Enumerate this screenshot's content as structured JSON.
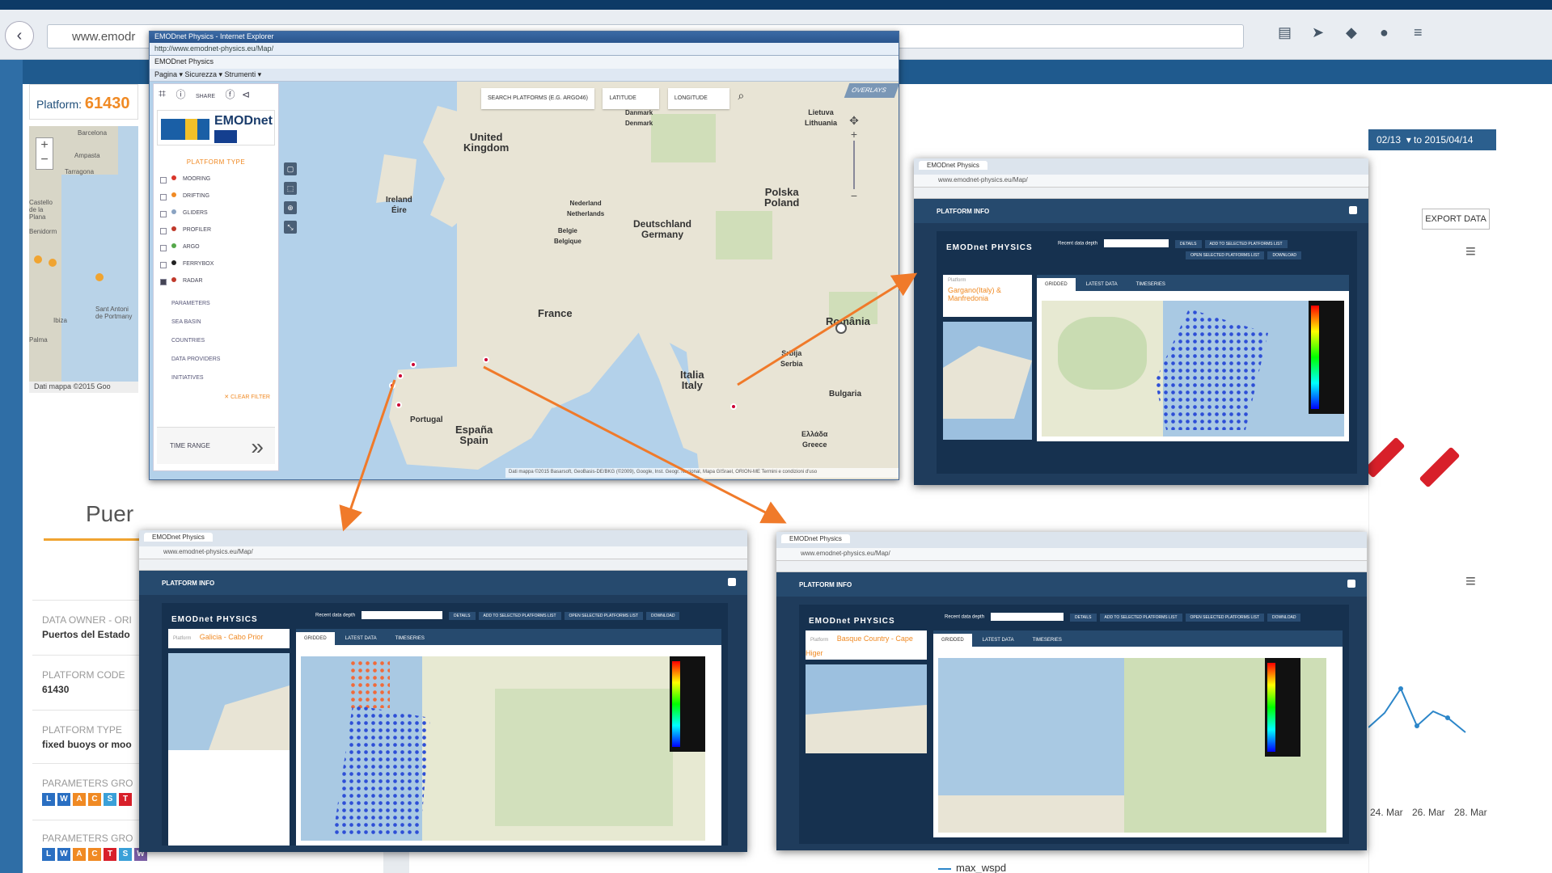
{
  "background": {
    "url": "www.emodr",
    "platform_label": "Platform:",
    "platform_code": "61430",
    "page_title_fragment": "Puer",
    "date_to": "02/13",
    "date_range": "▾ to  2015/04/14",
    "export_label": "EXPORT DATA",
    "mini_map_credit": "Dati mappa ©2015 Goo",
    "fields": [
      {
        "key": "DATA OWNER - ORI",
        "value": "Puertos del Estado"
      },
      {
        "key": "PLATFORM CODE",
        "value": "61430"
      },
      {
        "key": "PLATFORM TYPE",
        "value": "fixed buoys or moo"
      },
      {
        "key": "PARAMETERS GRO",
        "value": ""
      },
      {
        "key": "PARAMETERS GRO",
        "value": ""
      }
    ],
    "param_chips": [
      "L",
      "W",
      "A",
      "C",
      "S",
      "T"
    ],
    "mini_places": [
      "Ampasta",
      "Barcelo",
      "Tarragona",
      "Castello de la Plana",
      "Benidorm",
      "Ibiza",
      "Palma",
      "Sant Antoni de Portmany",
      "Barcelona"
    ],
    "chart_axis": [
      "24. Mar",
      "26. Mar",
      "28. Mar"
    ],
    "legend": "max_wspd"
  },
  "ie_window": {
    "title": "EMODnet Physics - Internet Explorer",
    "address": "http://www.emodnet-physics.eu/Map/",
    "tab_label": "EMODnet Physics",
    "command_bar": "Pagina ▾   Sicurezza ▾   Strumenti ▾",
    "sidebar": {
      "share_label": "SHARE",
      "logo_text": "EMODnet",
      "list_header": "PLATFORM TYPE",
      "platform_types": [
        {
          "label": "MOORING",
          "color": "#d9362b",
          "checked": false
        },
        {
          "label": "DRIFTING",
          "color": "#f08a24",
          "checked": false
        },
        {
          "label": "GLIDERS",
          "color": "#8aa3c2",
          "checked": false
        },
        {
          "label": "PROFILER",
          "color": "#c0392b",
          "checked": false
        },
        {
          "label": "ARGO",
          "color": "#55a84a",
          "checked": false
        },
        {
          "label": "FERRYBOX",
          "color": "#222222",
          "checked": false
        },
        {
          "label": "RADAR",
          "color": "#c0392b",
          "checked": true
        }
      ],
      "menu_items": [
        "PARAMETERS",
        "SEA BASIN",
        "COUNTRIES",
        "DATA PROVIDERS",
        "INITIATIVES"
      ],
      "clear_filter": "✕ CLEAR FILTER",
      "time_range": "TIME RANGE"
    },
    "search": {
      "placeholder": "SEARCH PLATFORMS (E.G. ARGO46)",
      "latitude": "LATITUDE",
      "longitude": "LONGITUDE"
    },
    "overlays": "OVERLAYS",
    "map_footer": "Dati mappa ©2015 Basarsoft, GeoBasis-DE/BKG (©2009), Google, Inst. Geogr. Nacional, Mapa GISrael, ORION-ME   Termini e condizioni d'uso",
    "countries": [
      {
        "name": "United\nKingdom"
      },
      {
        "name": "Ireland\nÉire"
      },
      {
        "name": "Nederland\nNetherlands"
      },
      {
        "name": "Belgie\nBelgique"
      },
      {
        "name": "Deutschland\nGermany"
      },
      {
        "name": "Polska\nPoland"
      },
      {
        "name": "France"
      },
      {
        "name": "Italia\nItaly"
      },
      {
        "name": "Portugal"
      },
      {
        "name": "España\nSpain"
      },
      {
        "name": "România"
      },
      {
        "name": "Lietuva\nLithuania"
      },
      {
        "name": "Danmark\nDenmark"
      },
      {
        "name": "Srbija\nSerbia"
      },
      {
        "name": "Bulgaria"
      },
      {
        "name": "Ελλάδα\nGreece"
      }
    ]
  },
  "popups": [
    {
      "tab": "EMODnet Physics",
      "address": "www.emodnet-physics.eu/Map/",
      "header": "PLATFORM INFO",
      "brand": "EMODnet PHYSICS",
      "recent_label": "Recent data depth",
      "platform_label": "Platform",
      "platform_name": "Gargano(Italy) & Manfredonia",
      "tabs": [
        "GRIDDED",
        "LATEST DATA",
        "TIMESERIES"
      ],
      "buttons": [
        "DETAILS",
        "ADD TO SELECTED PLATFORMS LIST",
        "OPEN SELECTED PLATFORMS LIST",
        "DOWNLOAD"
      ]
    },
    {
      "tab": "EMODnet Physics",
      "address": "www.emodnet-physics.eu/Map/",
      "header": "PLATFORM INFO",
      "brand": "EMODnet PHYSICS",
      "recent_label": "Recent data depth",
      "platform_label": "Platform",
      "platform_name": "Galicia - Cabo Prior",
      "tabs": [
        "GRIDDED",
        "LATEST DATA",
        "TIMESERIES"
      ],
      "buttons": [
        "DETAILS",
        "ADD TO SELECTED PLATFORMS LIST",
        "OPEN SELECTED PLATFORMS LIST",
        "DOWNLOAD"
      ]
    },
    {
      "tab": "EMODnet Physics",
      "address": "www.emodnet-physics.eu/Map/",
      "header": "PLATFORM INFO",
      "brand": "EMODnet PHYSICS",
      "recent_label": "Recent data depth",
      "platform_label": "Platform",
      "platform_name": "Basque Country - Cape Higer",
      "tabs": [
        "GRIDDED",
        "LATEST DATA",
        "TIMESERIES"
      ],
      "buttons": [
        "DETAILS",
        "ADD TO SELECTED PLATFORMS LIST",
        "OPEN SELECTED PLATFORMS LIST",
        "DOWNLOAD"
      ]
    }
  ],
  "colors": {
    "accent": "#f08a24",
    "dark_blue": "#1f3c5c",
    "arrow": "#f07a2a",
    "marker": "#cc0033"
  }
}
